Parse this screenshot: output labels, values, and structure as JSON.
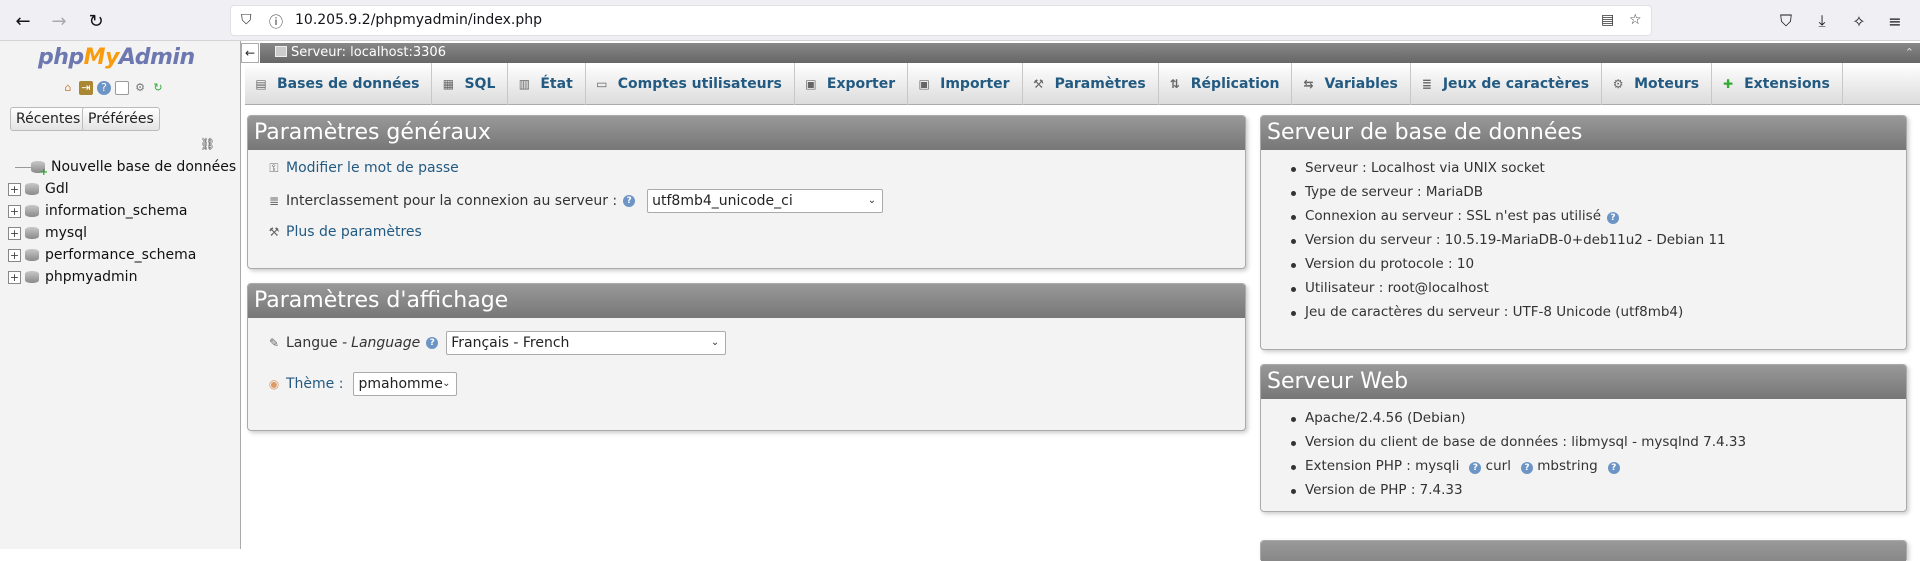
{
  "browser": {
    "url": "10.205.9.2/phpmyadmin/index.php"
  },
  "left": {
    "logo_php": "php",
    "logo_my": "My",
    "logo_admin": "Admin",
    "recent_button": "Récentes",
    "favorites_button": "Préférées",
    "tree": [
      {
        "label": "Nouvelle base de données"
      },
      {
        "label": "Gdl"
      },
      {
        "label": "information_schema"
      },
      {
        "label": "mysql"
      },
      {
        "label": "performance_schema"
      },
      {
        "label": "phpmyadmin"
      }
    ]
  },
  "serverbar": {
    "label": "Serveur: localhost:3306"
  },
  "tabs": [
    {
      "label": "Bases de données",
      "icon": "database-icon"
    },
    {
      "label": "SQL",
      "icon": "sql-icon"
    },
    {
      "label": "État",
      "icon": "status-icon"
    },
    {
      "label": "Comptes utilisateurs",
      "icon": "users-icon"
    },
    {
      "label": "Exporter",
      "icon": "export-icon"
    },
    {
      "label": "Importer",
      "icon": "import-icon"
    },
    {
      "label": "Paramètres",
      "icon": "wrench-icon"
    },
    {
      "label": "Réplication",
      "icon": "replication-icon"
    },
    {
      "label": "Variables",
      "icon": "variables-icon"
    },
    {
      "label": "Jeux de caractères",
      "icon": "charset-icon"
    },
    {
      "label": "Moteurs",
      "icon": "engine-icon"
    },
    {
      "label": "Extensions",
      "icon": "puzzle-icon"
    }
  ],
  "general": {
    "title": "Paramètres généraux",
    "change_password": "Modifier le mot de passe",
    "collation_label": "Interclassement pour la connexion au serveur :",
    "collation_value": "utf8mb4_unicode_ci",
    "more_settings": "Plus de paramètres"
  },
  "display": {
    "title": "Paramètres d'affichage",
    "language_label": "Langue - ",
    "language_label_italic": "Language",
    "language_value": "Français - French",
    "theme_label": "Thème :",
    "theme_value": "pmahomme"
  },
  "dbserver": {
    "title": "Serveur de base de données",
    "items": [
      "Serveur : Localhost via UNIX socket",
      "Type de serveur : MariaDB",
      "Connexion au serveur : SSL n'est pas utilisé",
      "Version du serveur : 10.5.19-MariaDB-0+deb11u2 - Debian 11",
      "Version du protocole : 10",
      "Utilisateur : root@localhost",
      "Jeu de caractères du serveur : UTF-8 Unicode (utf8mb4)"
    ]
  },
  "webserver": {
    "title": "Serveur Web",
    "items": [
      "Apache/2.4.56 (Debian)",
      "Version du client de base de données : libmysql - mysqlnd 7.4.33",
      "Extension PHP : mysqli",
      "Version de PHP : 7.4.33"
    ],
    "ext_curl": "curl",
    "ext_mbstring": "mbstring"
  }
}
